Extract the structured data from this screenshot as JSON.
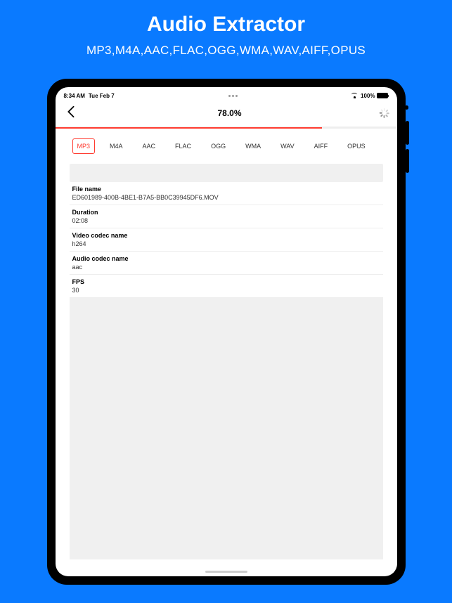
{
  "promo": {
    "title": "Audio Extractor",
    "subtitle": "MP3,M4A,AAC,FLAC,OGG,WMA,WAV,AIFF,OPUS"
  },
  "statusbar": {
    "time": "8:34 AM",
    "date": "Tue Feb 7",
    "battery": "100%"
  },
  "nav": {
    "progress_text": "78.0%",
    "progress_value": 78
  },
  "formats": [
    {
      "label": "MP3",
      "active": true
    },
    {
      "label": "M4A",
      "active": false
    },
    {
      "label": "AAC",
      "active": false
    },
    {
      "label": "FLAC",
      "active": false
    },
    {
      "label": "OGG",
      "active": false
    },
    {
      "label": "WMA",
      "active": false
    },
    {
      "label": "WAV",
      "active": false
    },
    {
      "label": "AIFF",
      "active": false
    },
    {
      "label": "OPUS",
      "active": false
    }
  ],
  "info": {
    "file_name_label": "File name",
    "file_name_value": "ED601989-400B-4BE1-B7A5-BB0C39945DF6.MOV",
    "duration_label": "Duration",
    "duration_value": "02:08",
    "video_codec_label": "Video codec name",
    "video_codec_value": "h264",
    "audio_codec_label": "Audio codec name",
    "audio_codec_value": "aac",
    "fps_label": "FPS",
    "fps_value": "30"
  }
}
